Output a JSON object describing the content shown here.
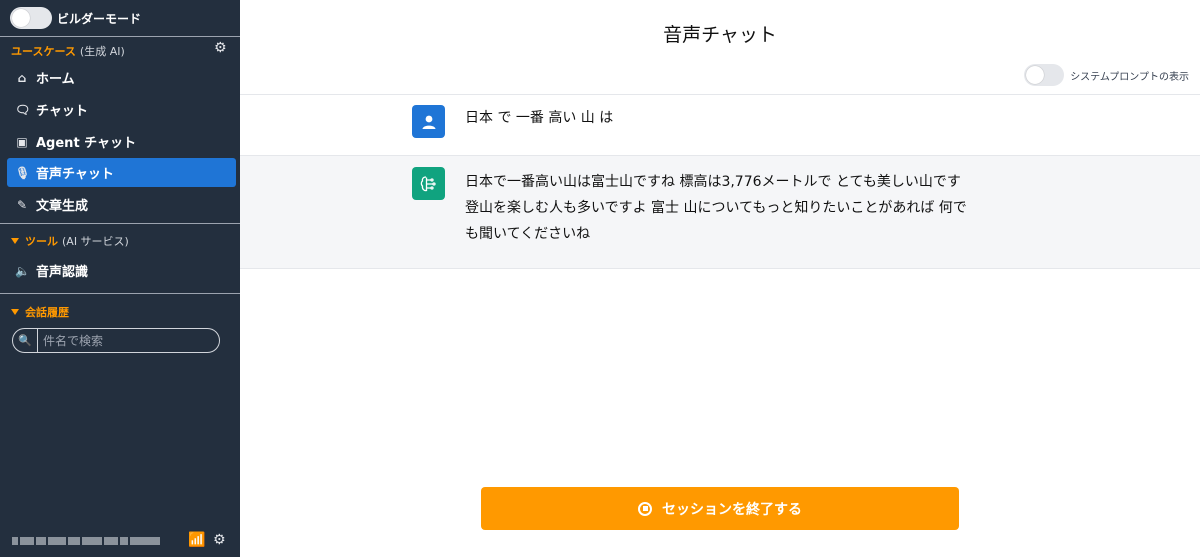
{
  "sidebar": {
    "builder_mode": {
      "label": "ビルダーモード",
      "on": false
    },
    "usecase_section": {
      "label": "ユースケース",
      "sub": "(生成 AI)"
    },
    "nav": [
      {
        "label": "ホーム",
        "icon": "home-icon"
      },
      {
        "label": "チャット",
        "icon": "chat-icon"
      },
      {
        "label": "Agent チャット",
        "icon": "robot-icon"
      },
      {
        "label": "音声チャット",
        "icon": "microphone-icon",
        "active": true
      },
      {
        "label": "文章生成",
        "icon": "pencil-icon"
      }
    ],
    "tools_section": {
      "label": "ツール",
      "sub": "(AI サービス)"
    },
    "tools": [
      {
        "label": "音声認識",
        "icon": "speaker-icon"
      }
    ],
    "history_section": {
      "label": "会話履歴"
    },
    "search": {
      "placeholder": "件名で検索",
      "value": ""
    }
  },
  "main": {
    "title": "音声チャット",
    "system_prompt_toggle": {
      "label": "システムプロンプトの表示",
      "on": false
    },
    "messages": [
      {
        "role": "user",
        "text": "日本 で 一番 高い 山 は"
      },
      {
        "role": "assistant",
        "text": "日本で一番高い山は富士山ですね 標高は3,776メートルで とても美しい山です 登山を楽しむ人も多いですよ 富士 山についてもっと知りたいことがあれば 何でも聞いてくださいね"
      }
    ],
    "end_session_button": {
      "label": "セッションを終了する"
    }
  },
  "colors": {
    "sidebar_bg": "#232f3e",
    "accent_orange": "#ff9900",
    "active_blue": "#1f75d6",
    "assistant_green": "#10a37f"
  }
}
